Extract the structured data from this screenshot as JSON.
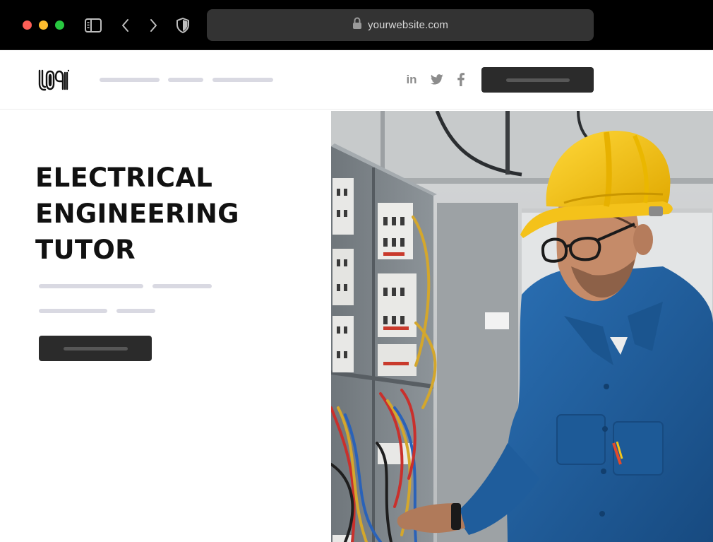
{
  "browser": {
    "url": "yourwebsite.com",
    "icons": [
      "sidebar-icon",
      "back-arrow-icon",
      "forward-arrow-icon",
      "shield-icon",
      "lock-icon"
    ]
  },
  "header": {
    "logo_text": "LO9I",
    "social": {
      "linkedin": "in",
      "twitter": "twitter-icon",
      "facebook": "facebook-icon"
    }
  },
  "hero": {
    "title_lines": [
      "ELECTRICAL",
      "ENGINEERING",
      "TUTOR"
    ],
    "image_alt": "Electrician in a yellow hard hat and blue work shirt inspecting wiring in an electrical panel"
  },
  "colors": {
    "chrome_bg": "#000000",
    "urlbar_bg": "#333333",
    "button_bg": "#2b2b2b",
    "placeholder_line": "#d9d9e2",
    "title_text": "#111111",
    "hard_hat": "#f5c518",
    "work_shirt": "#1f5d9c"
  }
}
